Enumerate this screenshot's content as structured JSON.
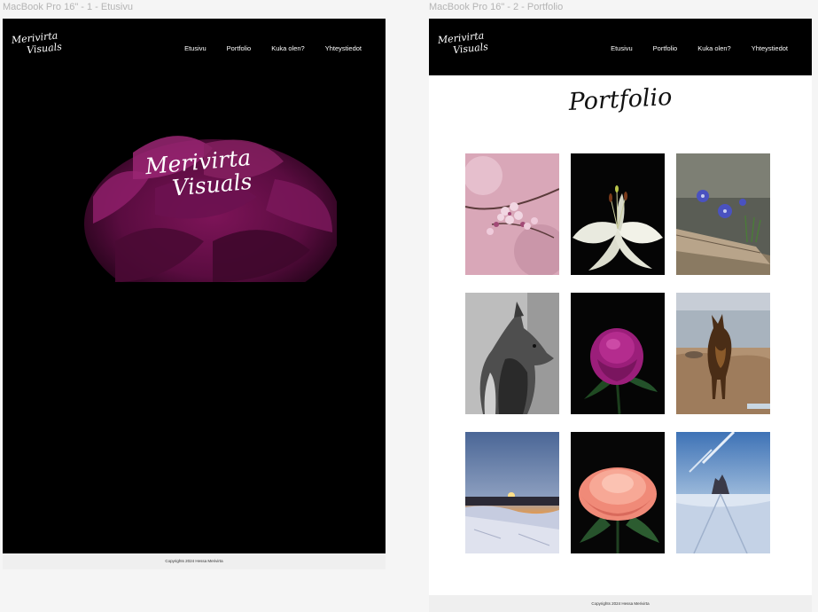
{
  "frames": [
    {
      "label": "MacBook Pro 16\" - 1 - Etusivu"
    },
    {
      "label": "MacBook Pro 16\" - 2 - Portfolio"
    }
  ],
  "site": {
    "logo_line1": "Merivirta",
    "logo_line2": "Visuals",
    "nav": [
      "Etusivu",
      "Portfolio",
      "Kuka olen?",
      "Yhteystiedot"
    ],
    "footer": "Copyrights 2024 Hessa Merivirta"
  },
  "home": {
    "hero_line1": "Merivirta",
    "hero_line2": "Visuals"
  },
  "portfolio": {
    "title": "Portfolio",
    "items": [
      {
        "name": "cherry-blossom-photo"
      },
      {
        "name": "white-lily-photo"
      },
      {
        "name": "blue-hepatica-photo"
      },
      {
        "name": "bw-dog-portrait-photo"
      },
      {
        "name": "pink-peony-photo"
      },
      {
        "name": "dog-on-beach-photo"
      },
      {
        "name": "winter-sunset-photo"
      },
      {
        "name": "peach-rose-photo"
      },
      {
        "name": "snowy-landscape-photo"
      }
    ]
  }
}
